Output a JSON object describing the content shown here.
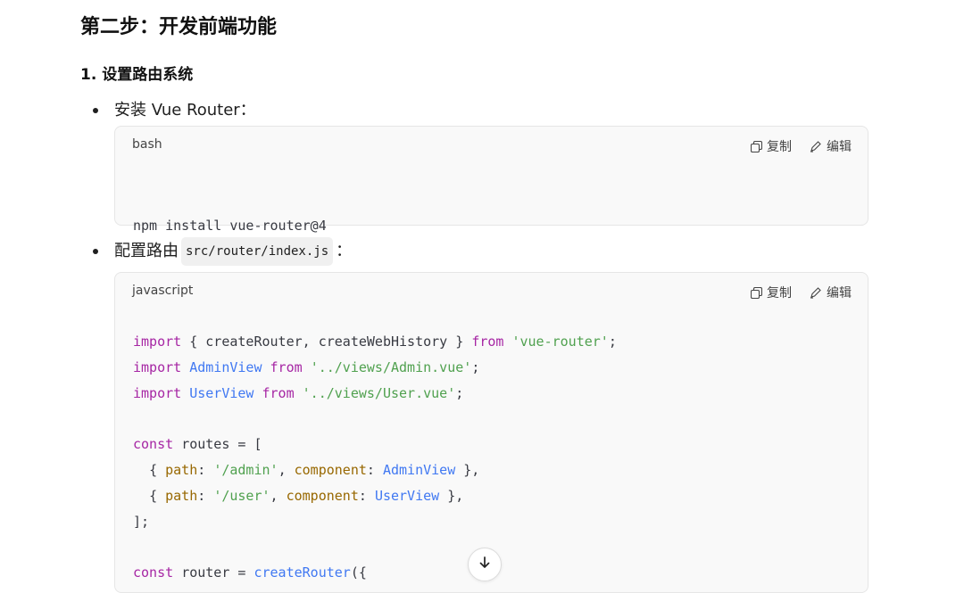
{
  "heading": "第二步：开发前端功能",
  "subheading": "1. 设置路由系统",
  "bullets": [
    {
      "text": "安装 Vue Router："
    },
    {
      "text_before": "配置路由 ",
      "inline_code": "src/router/index.js",
      "text_after": "："
    }
  ],
  "code_blocks": [
    {
      "language": "bash",
      "copy_label": "复制",
      "edit_label": "编辑",
      "lines": [
        "npm install vue-router@4"
      ]
    },
    {
      "language": "javascript",
      "copy_label": "复制",
      "edit_label": "编辑",
      "lines": [
        "import { createRouter, createWebHistory } from 'vue-router';",
        "import AdminView from '../views/Admin.vue';",
        "import UserView from '../views/User.vue';",
        "",
        "const routes = [",
        "  { path: '/admin', component: AdminView },",
        "  { path: '/user', component: UserView },",
        "];",
        "",
        "const router = createRouter({"
      ]
    }
  ],
  "icons": {
    "copy": "copy-icon",
    "edit": "pencil-icon",
    "scroll": "arrow-down-icon"
  },
  "colors": {
    "keyword": "#a626a4",
    "function": "#4078f2",
    "string": "#50a14f",
    "property": "#986801"
  }
}
